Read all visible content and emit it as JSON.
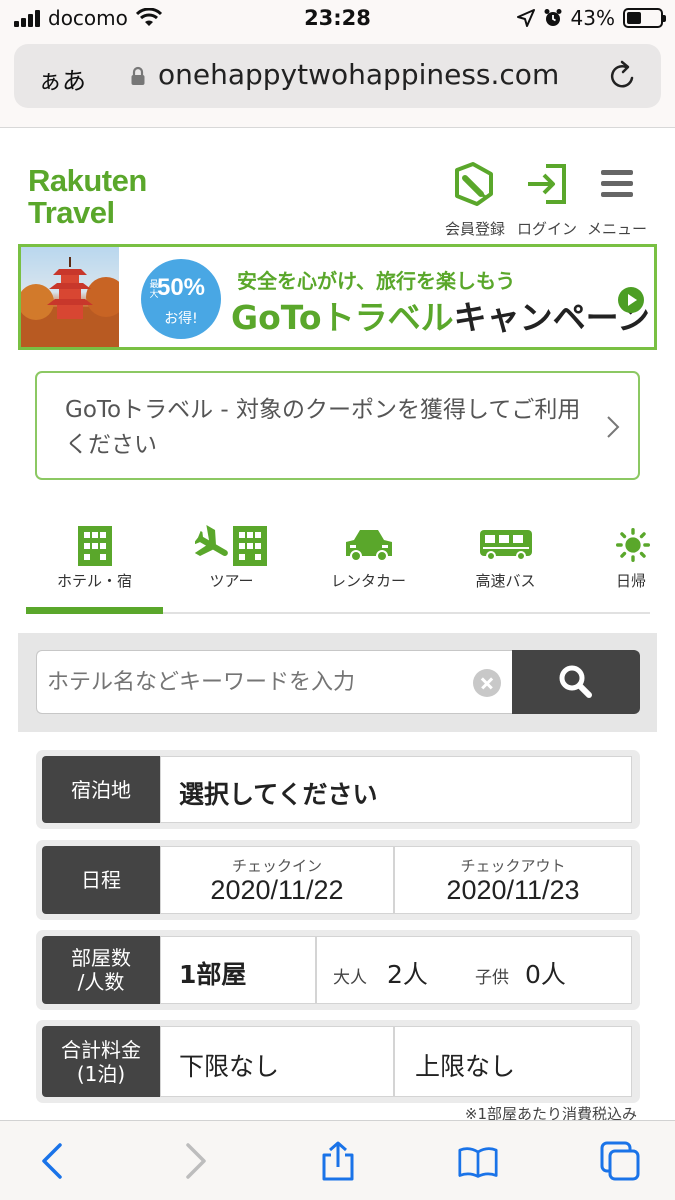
{
  "status_bar": {
    "carrier": "docomo",
    "time": "23:28",
    "battery": "43%"
  },
  "browser": {
    "aa_label": "ぁあ",
    "url": "onehappytwohappiness.com"
  },
  "header": {
    "logo_line1": "Rakuten",
    "logo_line2": "Travel",
    "register_label": "会員登録",
    "login_label": "ログイン",
    "menu_label": "メニュー"
  },
  "banner": {
    "badge_max": "最大",
    "badge_percent": "50%",
    "badge_otoku": "お得!",
    "subtitle": "安全を心がけ、旅行を楽しもう",
    "title_goto": "GoTo",
    "title_travel": "トラベル",
    "title_campaign": "キャンペーン"
  },
  "coupon": {
    "text": "GoToトラベル - 対象のクーポンを獲得してご利用ください"
  },
  "tabs": [
    {
      "label": "ホテル・宿",
      "icon": "building-icon",
      "active": true
    },
    {
      "label": "ツアー",
      "icon": "plane-hotel-icon",
      "active": false
    },
    {
      "label": "レンタカー",
      "icon": "car-icon",
      "active": false
    },
    {
      "label": "高速バス",
      "icon": "bus-icon",
      "active": false
    },
    {
      "label": "日帰",
      "icon": "sun-icon",
      "active": false
    }
  ],
  "search": {
    "placeholder": "ホテル名などキーワードを入力"
  },
  "form": {
    "destination": {
      "label": "宿泊地",
      "value": "選択してください"
    },
    "schedule": {
      "label": "日程",
      "checkin_label": "チェックイン",
      "checkin_value": "2020/11/22",
      "checkout_label": "チェックアウト",
      "checkout_value": "2020/11/23"
    },
    "rooms": {
      "label_line1": "部屋数",
      "label_line2": "/人数",
      "rooms_value": "1部屋",
      "adult_label": "大人",
      "adult_value": "2人",
      "child_label": "子供",
      "child_value": "0人"
    },
    "price": {
      "label_line1": "合計料金",
      "label_line2": "(1泊)",
      "min_value": "下限なし",
      "max_value": "上限なし"
    },
    "note": "※1部屋あたり消費税込み"
  },
  "colors": {
    "brand_green": "#5aa72b",
    "dark_label": "#444444",
    "badge_blue": "#49a7e4",
    "ios_blue": "#1a73e8"
  }
}
